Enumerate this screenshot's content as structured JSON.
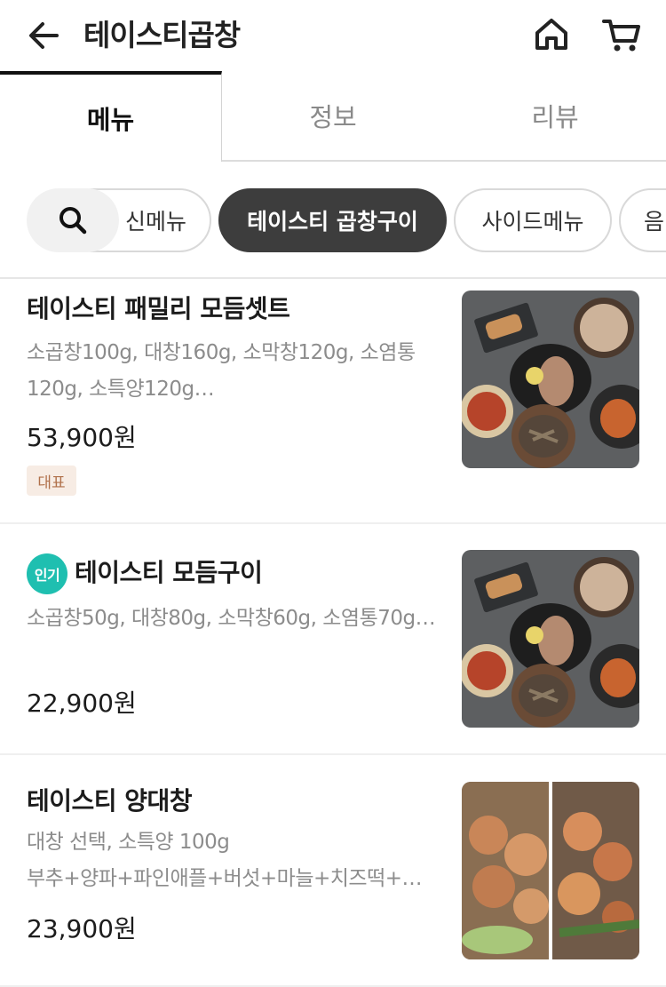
{
  "header": {
    "title": "테이스티곱창",
    "back_icon": "arrow-left-icon",
    "home_icon": "home-icon",
    "cart_icon": "cart-icon"
  },
  "tabs": [
    {
      "label": "메뉴",
      "active": true
    },
    {
      "label": "정보",
      "active": false
    },
    {
      "label": "리뷰",
      "active": false
    }
  ],
  "chips": {
    "search_icon": "search-icon",
    "items": [
      {
        "label": "신메뉴"
      },
      {
        "label": "테이스티 곱창구이",
        "active": true
      },
      {
        "label": "사이드메뉴"
      },
      {
        "label": "음"
      }
    ]
  },
  "menu_items": [
    {
      "name": "테이스티 패밀리 모듬셋트",
      "desc": "소곱창100g, 대창160g, 소막창120g, 소염통120g, 소특양120g…",
      "price": "53,900원",
      "badge": "대표"
    },
    {
      "name": "테이스티 모듬구이",
      "desc": "소곱창50g, 대창80g, 소막창60g, 소염통70g…",
      "price": "22,900원",
      "popular_badge": "인기"
    },
    {
      "name": "테이스티 양대창",
      "desc_line1": "대창 선택, 소특양 100g",
      "desc_line2": "부추+양파+파인애플+버섯+마늘+치즈떡+…",
      "price": "23,900원"
    }
  ],
  "colors": {
    "accent_teal": "#1fbfb0",
    "chip_active": "#3d3d3d",
    "badge_bg": "#f7ece4",
    "badge_text": "#b0704a"
  }
}
